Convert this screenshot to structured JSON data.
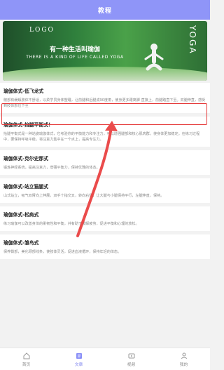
{
  "header": {
    "title": "教程"
  },
  "banner": {
    "logo": "LOGO",
    "title": "有一种生活叫瑜伽",
    "subtitle": "THERE IS A KIND OF LIFE CALLED YOGA",
    "side_text": "YOGA"
  },
  "articles": [
    {
      "title": "瑜伽体式-低飞龙式",
      "text": "髋部有缓解肢体不舒适，以柔学员身体塑睡，让前腿和后腿成90度角，使身更多跟离脚 直接上，前腿踏直下至。双腿伸直，感受到肢体部位下至"
    },
    {
      "title": "瑜伽体式-抬腿平衡式！",
      "text": "抬腿平衡式是一种站姿瑜伽体式，它考验你的平衡能力和专注力，可以增强腿部和核心肌肉群，使身体更加稳定。在练习过程中，要保持呼吸平稳，将注意力集中在一个点上，提高专注力。"
    },
    {
      "title": "瑜伽体式-克尔史那式",
      "text": "锻炼神经系统，提高注意力，增强平衡力，保持优雅的体态。"
    },
    {
      "title": "瑜伽体式-站立猫腿式",
      "text": "山式站立，吸气双臂向上伸展，双手十指交叉，转向右侧，让大腿与小腿保持平行，左腿伸直，保持。"
    },
    {
      "title": "瑜伽体式-松肩式",
      "text": "练习瑜伽可以改善身体的柔韧性和平衡，并有助于缓解疲劳，促进平衡和心理的放松。"
    },
    {
      "title": "瑜伽体式-雏鸟式",
      "text": "保养臀部，美化颈部线条，使肢体灵活，促进血液循环，保持年轻的体态。"
    }
  ],
  "nav": [
    {
      "label": "首页",
      "icon": "home-icon"
    },
    {
      "label": "文章",
      "icon": "article-icon",
      "active": true
    },
    {
      "label": "视频",
      "icon": "video-icon"
    },
    {
      "label": "我的",
      "icon": "user-icon"
    }
  ],
  "colors": {
    "header_bg": "#8f95f8",
    "highlight": "#e53a3a",
    "active_nav": "#7f85ef"
  }
}
